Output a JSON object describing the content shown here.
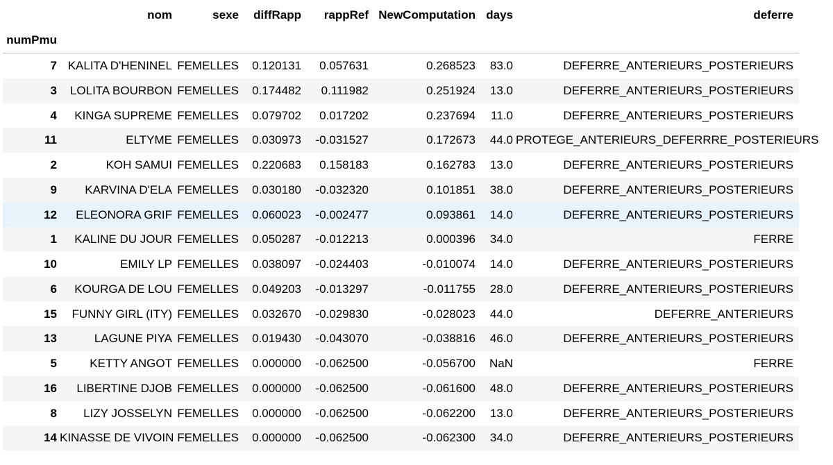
{
  "table": {
    "index_name": "numPmu",
    "columns": [
      "nom",
      "sexe",
      "diffRapp",
      "rappRef",
      "NewComputation",
      "days",
      "deferre"
    ],
    "highlighted_row": 6,
    "rows": [
      {
        "idx": "7",
        "nom": "KALITA D'HENINEL",
        "sexe": "FEMELLES",
        "diffRapp": "0.120131",
        "rappRef": "0.057631",
        "NewComputation": "0.268523",
        "days": "83.0",
        "deferre": "DEFERRE_ANTERIEURS_POSTERIEURS"
      },
      {
        "idx": "3",
        "nom": "LOLITA BOURBON",
        "sexe": "FEMELLES",
        "diffRapp": "0.174482",
        "rappRef": "0.111982",
        "NewComputation": "0.251924",
        "days": "13.0",
        "deferre": "DEFERRE_ANTERIEURS_POSTERIEURS"
      },
      {
        "idx": "4",
        "nom": "KINGA SUPREME",
        "sexe": "FEMELLES",
        "diffRapp": "0.079702",
        "rappRef": "0.017202",
        "NewComputation": "0.237694",
        "days": "11.0",
        "deferre": "DEFERRE_ANTERIEURS_POSTERIEURS"
      },
      {
        "idx": "11",
        "nom": "ELTYME",
        "sexe": "FEMELLES",
        "diffRapp": "0.030973",
        "rappRef": "-0.031527",
        "NewComputation": "0.172673",
        "days": "44.0",
        "deferre": "PROTEGE_ANTERIEURS_DEFERRRE_POSTERIEURS"
      },
      {
        "idx": "2",
        "nom": "KOH SAMUI",
        "sexe": "FEMELLES",
        "diffRapp": "0.220683",
        "rappRef": "0.158183",
        "NewComputation": "0.162783",
        "days": "13.0",
        "deferre": "DEFERRE_ANTERIEURS_POSTERIEURS"
      },
      {
        "idx": "9",
        "nom": "KARVINA D'ELA",
        "sexe": "FEMELLES",
        "diffRapp": "0.030180",
        "rappRef": "-0.032320",
        "NewComputation": "0.101851",
        "days": "38.0",
        "deferre": "DEFERRE_ANTERIEURS_POSTERIEURS"
      },
      {
        "idx": "12",
        "nom": "ELEONORA GRIF",
        "sexe": "FEMELLES",
        "diffRapp": "0.060023",
        "rappRef": "-0.002477",
        "NewComputation": "0.093861",
        "days": "14.0",
        "deferre": "DEFERRE_ANTERIEURS_POSTERIEURS"
      },
      {
        "idx": "1",
        "nom": "KALINE DU JOUR",
        "sexe": "FEMELLES",
        "diffRapp": "0.050287",
        "rappRef": "-0.012213",
        "NewComputation": "0.000396",
        "days": "34.0",
        "deferre": "FERRE"
      },
      {
        "idx": "10",
        "nom": "EMILY LP",
        "sexe": "FEMELLES",
        "diffRapp": "0.038097",
        "rappRef": "-0.024403",
        "NewComputation": "-0.010074",
        "days": "14.0",
        "deferre": "DEFERRE_ANTERIEURS_POSTERIEURS"
      },
      {
        "idx": "6",
        "nom": "KOURGA DE LOU",
        "sexe": "FEMELLES",
        "diffRapp": "0.049203",
        "rappRef": "-0.013297",
        "NewComputation": "-0.011755",
        "days": "28.0",
        "deferre": "DEFERRE_ANTERIEURS_POSTERIEURS"
      },
      {
        "idx": "15",
        "nom": "FUNNY GIRL (ITY)",
        "sexe": "FEMELLES",
        "diffRapp": "0.032670",
        "rappRef": "-0.029830",
        "NewComputation": "-0.028023",
        "days": "44.0",
        "deferre": "DEFERRE_ANTERIEURS"
      },
      {
        "idx": "13",
        "nom": "LAGUNE PIYA",
        "sexe": "FEMELLES",
        "diffRapp": "0.019430",
        "rappRef": "-0.043070",
        "NewComputation": "-0.038816",
        "days": "46.0",
        "deferre": "DEFERRE_ANTERIEURS_POSTERIEURS"
      },
      {
        "idx": "5",
        "nom": "KETTY ANGOT",
        "sexe": "FEMELLES",
        "diffRapp": "0.000000",
        "rappRef": "-0.062500",
        "NewComputation": "-0.056700",
        "days": "NaN",
        "deferre": "FERRE"
      },
      {
        "idx": "16",
        "nom": "LIBERTINE DJOB",
        "sexe": "FEMELLES",
        "diffRapp": "0.000000",
        "rappRef": "-0.062500",
        "NewComputation": "-0.061600",
        "days": "48.0",
        "deferre": "DEFERRE_ANTERIEURS_POSTERIEURS"
      },
      {
        "idx": "8",
        "nom": "LIZY JOSSELYN",
        "sexe": "FEMELLES",
        "diffRapp": "0.000000",
        "rappRef": "-0.062500",
        "NewComputation": "-0.062200",
        "days": "13.0",
        "deferre": "DEFERRE_ANTERIEURS_POSTERIEURS"
      },
      {
        "idx": "14",
        "nom": "KINASSE DE VIVOIN",
        "sexe": "FEMELLES",
        "diffRapp": "0.000000",
        "rappRef": "-0.062500",
        "NewComputation": "-0.062300",
        "days": "34.0",
        "deferre": "DEFERRE_ANTERIEURS_POSTERIEURS"
      }
    ]
  }
}
